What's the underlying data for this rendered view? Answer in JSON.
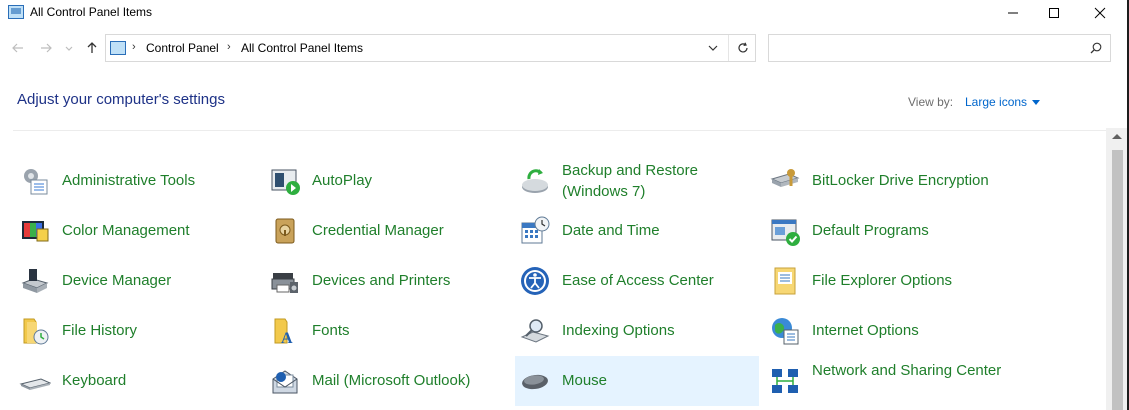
{
  "window": {
    "title": "All Control Panel Items"
  },
  "address": {
    "crumbs": [
      "Control Panel",
      "All Control Panel Items"
    ]
  },
  "search": {
    "placeholder": "",
    "value": ""
  },
  "header": {
    "title": "Adjust your computer's settings",
    "view_by_label": "View by:",
    "view_by_value": "Large icons"
  },
  "items": [
    {
      "label": "Administrative Tools",
      "icon": "administrative-tools-icon"
    },
    {
      "label": "AutoPlay",
      "icon": "autoplay-icon"
    },
    {
      "label": "Backup and Restore (Windows 7)",
      "icon": "backup-restore-icon"
    },
    {
      "label": "BitLocker Drive Encryption",
      "icon": "bitlocker-icon"
    },
    {
      "label": "Color Management",
      "icon": "color-management-icon"
    },
    {
      "label": "Credential Manager",
      "icon": "credential-manager-icon"
    },
    {
      "label": "Date and Time",
      "icon": "date-time-icon"
    },
    {
      "label": "Default Programs",
      "icon": "default-programs-icon"
    },
    {
      "label": "Device Manager",
      "icon": "device-manager-icon"
    },
    {
      "label": "Devices and Printers",
      "icon": "devices-printers-icon"
    },
    {
      "label": "Ease of Access Center",
      "icon": "ease-of-access-icon"
    },
    {
      "label": "File Explorer Options",
      "icon": "file-explorer-options-icon"
    },
    {
      "label": "File History",
      "icon": "file-history-icon"
    },
    {
      "label": "Fonts",
      "icon": "fonts-icon"
    },
    {
      "label": "Indexing Options",
      "icon": "indexing-options-icon"
    },
    {
      "label": "Internet Options",
      "icon": "internet-options-icon"
    },
    {
      "label": "Keyboard",
      "icon": "keyboard-icon"
    },
    {
      "label": "Mail (Microsoft Outlook)",
      "icon": "mail-icon"
    },
    {
      "label": "Mouse",
      "icon": "mouse-icon"
    },
    {
      "label": "Network and Sharing Center",
      "icon": "network-sharing-icon"
    }
  ],
  "colors": {
    "link_green": "#1f7f2b",
    "heading_blue": "#1e3287",
    "accent_blue": "#0066cc",
    "hover_bg": "#e5f3ff"
  }
}
